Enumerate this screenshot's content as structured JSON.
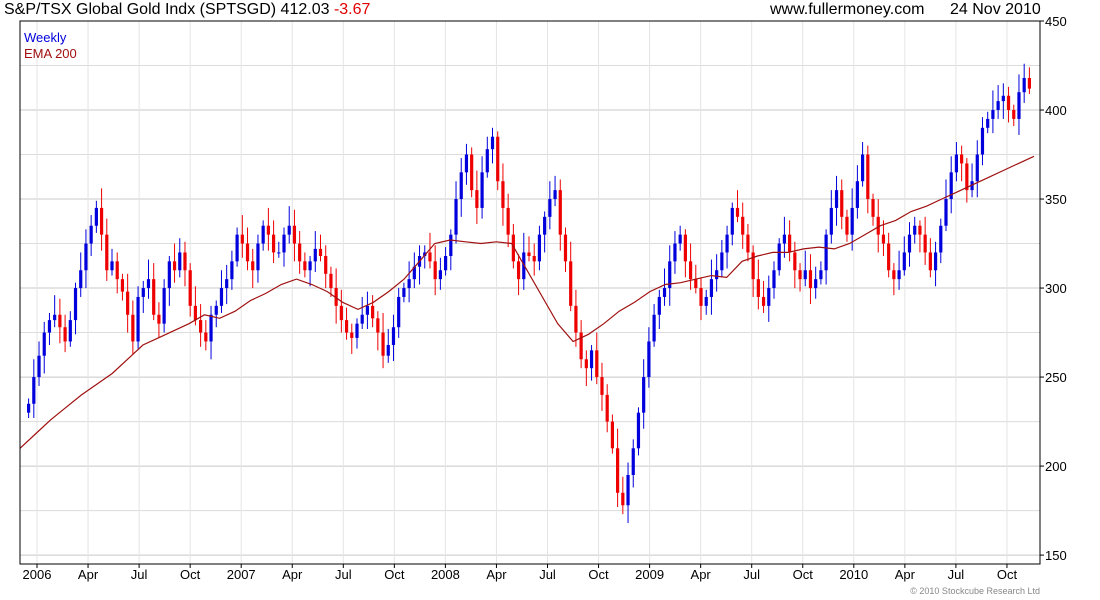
{
  "header": {
    "title": "S&P/TSX Global Gold Indx (SPTSGD)",
    "last": "412.03",
    "change": "-3.67",
    "website": "www.fullermoney.com",
    "date": "24 Nov 2010"
  },
  "legend": {
    "weekly": "Weekly",
    "ema": "EMA 200"
  },
  "copyright": "© 2010 Stockcube Research Ltd",
  "colors": {
    "up": "#0000dd",
    "down": "#ee0000",
    "ema": "#a01010",
    "grid": "#dcdcdc",
    "axis": "#000000"
  },
  "chart_data": {
    "type": "candlestick",
    "frequency": "Weekly",
    "ylim": [
      145,
      450
    ],
    "y_ticks": [
      150,
      200,
      250,
      300,
      350,
      400,
      450
    ],
    "x_ticks": [
      "2006",
      "Apr",
      "Jul",
      "Oct",
      "2007",
      "Apr",
      "Jul",
      "Oct",
      "2008",
      "Apr",
      "Jul",
      "Oct",
      "2009",
      "Apr",
      "Jul",
      "Oct",
      "2010",
      "Apr",
      "Jul",
      "Oct"
    ],
    "close_approx": [
      235,
      250,
      262,
      275,
      282,
      285,
      278,
      270,
      282,
      300,
      310,
      325,
      335,
      345,
      330,
      310,
      315,
      305,
      298,
      285,
      270,
      295,
      300,
      305,
      285,
      280,
      300,
      315,
      310,
      320,
      310,
      290,
      282,
      275,
      270,
      285,
      290,
      300,
      305,
      315,
      330,
      325,
      315,
      310,
      325,
      335,
      330,
      320,
      320,
      330,
      335,
      325,
      315,
      310,
      315,
      322,
      318,
      308,
      300,
      290,
      282,
      275,
      272,
      280,
      285,
      290,
      283,
      275,
      262,
      268,
      278,
      295,
      300,
      305,
      312,
      318,
      320,
      315,
      305,
      310,
      318,
      330,
      350,
      365,
      375,
      355,
      345,
      365,
      378,
      385,
      360,
      345,
      330,
      315,
      305,
      320,
      318,
      315,
      330,
      340,
      350,
      355,
      330,
      315,
      290,
      275,
      260,
      255,
      265,
      250,
      240,
      225,
      210,
      185,
      178,
      195,
      210,
      230,
      250,
      270,
      285,
      295,
      300,
      315,
      325,
      330,
      315,
      305,
      300,
      290,
      295,
      305,
      310,
      320,
      330,
      345,
      340,
      330,
      320,
      305,
      295,
      290,
      300,
      310,
      325,
      330,
      320,
      310,
      305,
      310,
      300,
      305,
      310,
      330,
      345,
      355,
      340,
      330,
      345,
      360,
      375,
      350,
      340,
      330,
      325,
      310,
      305,
      310,
      320,
      330,
      335,
      330,
      320,
      310,
      320,
      335,
      350,
      365,
      375,
      370,
      355,
      360,
      375,
      390,
      395,
      400,
      405,
      408,
      400,
      395,
      410,
      418,
      412
    ],
    "ema200_approx": [
      210,
      218,
      226,
      233,
      240,
      246,
      252,
      260,
      268,
      272,
      276,
      280,
      285,
      283,
      287,
      293,
      297,
      302,
      305,
      302,
      298,
      292,
      288,
      292,
      298,
      305,
      315,
      325,
      327,
      326,
      325,
      326,
      325,
      310,
      295,
      280,
      270,
      274,
      280,
      287,
      292,
      298,
      302,
      303,
      305,
      307,
      306,
      315,
      318,
      320,
      320,
      322,
      323,
      322,
      325,
      330,
      335,
      338,
      343,
      346,
      350,
      354,
      358,
      362,
      366,
      370,
      374
    ]
  }
}
